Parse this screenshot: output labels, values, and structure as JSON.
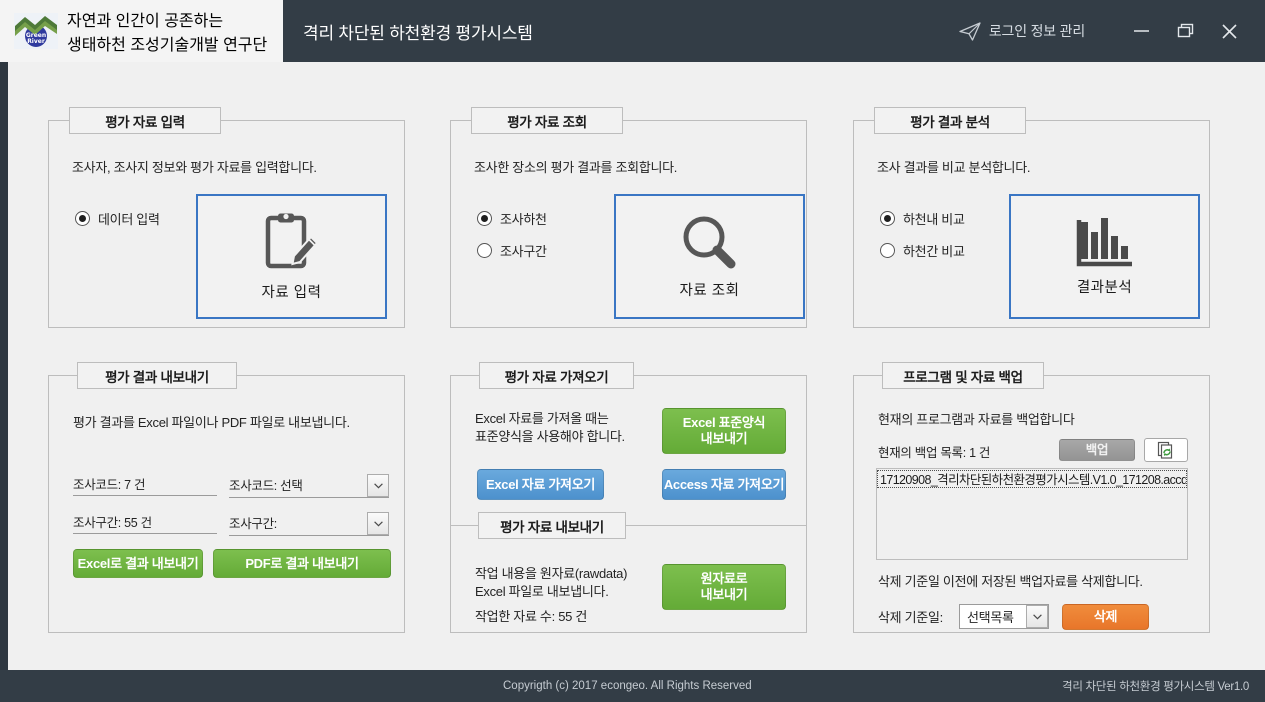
{
  "window": {
    "logo_line1": "자연과 인간이 공존하는",
    "logo_line2": "생태하천 조성기술개발 연구단",
    "logo_mark_text": "Green River",
    "app_title": "격리 차단된 하천환경 평가시스템",
    "login_label": "로그인 정보 관리",
    "minimize_label": "—",
    "restore_label": "restore",
    "close_label": "✕",
    "accent_blue": "#3a76c4",
    "titlebar_color": "#333d46",
    "content_color": "#f0f0f0"
  },
  "panel_input": {
    "legend": "평가 자료 입력",
    "description": "조사자, 조사지 정보와 평가 자료를 입력합니다.",
    "radios": [
      {
        "label": "데이터 입력",
        "checked": true
      }
    ],
    "button_caption": "자료 입력",
    "button_icon": "clipboard-pencil-icon"
  },
  "panel_search": {
    "legend": "평가 자료 조회",
    "description": "조사한 장소의 평가 결과를 조회합니다.",
    "radios": [
      {
        "label": "조사하천",
        "checked": true
      },
      {
        "label": "조사구간",
        "checked": false
      }
    ],
    "button_caption": "자료 조회",
    "button_icon": "magnifier-icon"
  },
  "panel_analysis": {
    "legend": "평가 결과 분석",
    "description": "조사 결과를 비교 분석합니다.",
    "radios": [
      {
        "label": "하천내 비교",
        "checked": true
      },
      {
        "label": "하천간 비교",
        "checked": false
      }
    ],
    "button_caption": "결과분석",
    "button_icon": "bar-chart-icon"
  },
  "panel_export": {
    "legend": "평가 결과 내보내기",
    "description": "평가 결과를 Excel 파일이나 PDF 파일로 내보냅니다.",
    "count_code": "조사코드:  7 건",
    "count_section": "조사구간:  55 건",
    "combo_code_label": "조사코드:  선택",
    "combo_section_label": "조사구간:",
    "btn_excel": "Excel로 결과 내보내기",
    "btn_pdf": "PDF로 결과 내보내기"
  },
  "panel_import": {
    "legend": "평가 자료 가져오기",
    "description": "Excel 자료를 가져올 때는\n표준양식을 사용해야 합니다.",
    "btn_excel_template": "Excel 표준양식\n내보내기",
    "btn_excel_import": "Excel 자료 가져오기",
    "btn_access_import": "Access 자료 가져오기",
    "sub_legend": "평가 자료 내보내기",
    "sub_description": "작업 내용을 원자료(rawdata)\nExcel 파일로 내보냅니다.",
    "sub_count": "작업한 자료 수: 55 건",
    "btn_raw_export": "원자료로\n내보내기"
  },
  "panel_backup": {
    "legend": "프로그램 및 자료 백업",
    "description": "현재의 프로그램과 자료를 백업합니다",
    "list_count_label": "현재의 백업 목록: 1 건",
    "btn_backup": "백업",
    "refresh_icon": "refresh-copy-icon",
    "backup_files": [
      "17120908_격리차단된하천환경평가시스템.V1.0_171208.accd"
    ],
    "delete_description": "삭제 기준일 이전에 저장된 백업자료를 삭제합니다.",
    "delete_date_label": "삭제 기준일:",
    "delete_combo_value": "선택목록",
    "btn_delete": "삭제"
  },
  "footer": {
    "copyright": "Copyrigth (c) 2017 econgeo. All Rights Reserved",
    "version": "격리 차단된 하천환경 평가시스템 Ver1.0"
  }
}
